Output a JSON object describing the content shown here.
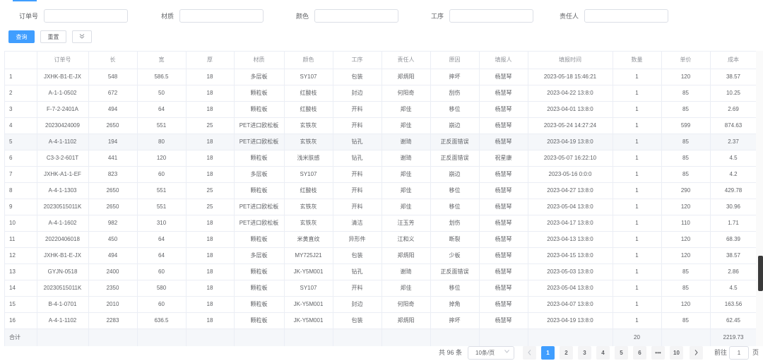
{
  "filters": [
    {
      "label": "订单号",
      "placeholder": "",
      "value": ""
    },
    {
      "label": "材质",
      "placeholder": "",
      "value": ""
    },
    {
      "label": "颜色",
      "placeholder": "",
      "value": ""
    },
    {
      "label": "工序",
      "placeholder": "",
      "value": ""
    },
    {
      "label": "责任人",
      "placeholder": "",
      "value": ""
    }
  ],
  "actions": {
    "search_label": "查询",
    "reset_label": "重置",
    "expand_icon": "chevron-double-down-icon"
  },
  "table": {
    "columns": [
      "",
      "订单号",
      "长",
      "宽",
      "厚",
      "材质",
      "颜色",
      "工序",
      "责任人",
      "原因",
      "填报人",
      "填报时间",
      "数量",
      "单价",
      "成本"
    ],
    "rows": [
      [
        "1",
        "JXHK-B1-E-JX",
        "548",
        "586.5",
        "18",
        "多层板",
        "SY107",
        "包装",
        "郑炳阳",
        "摔坏",
        "杨慧琴",
        "2023-05-18 15:46:21",
        "1",
        "120",
        "38.57"
      ],
      [
        "2",
        "A-1-1-0502",
        "672",
        "50",
        "18",
        "颗粒板",
        "红酸枝",
        "封边",
        "何阳奇",
        "刮伤",
        "杨慧琴",
        "2023-04-22 13:8:0",
        "1",
        "85",
        "10.25"
      ],
      [
        "3",
        "F-7-2-2401A",
        "494",
        "64",
        "18",
        "颗粒板",
        "红酸枝",
        "开料",
        "郑佳",
        "移位",
        "杨慧琴",
        "2023-04-01 13:8:0",
        "1",
        "85",
        "2.69"
      ],
      [
        "4",
        "20230424009",
        "2650",
        "551",
        "25",
        "PET进口欧松板",
        "玄铁灰",
        "开料",
        "郑佳",
        "崩边",
        "杨慧琴",
        "2023-05-24 14:27:24",
        "1",
        "599",
        "874.63"
      ],
      [
        "5",
        "A-4-1-1102",
        "194",
        "80",
        "18",
        "PET进口欧松板",
        "玄铁灰",
        "钻孔",
        "谢琦",
        "正反面错误",
        "杨慧琴",
        "2023-04-19 13:8:0",
        "1",
        "85",
        "2.37"
      ],
      [
        "6",
        "C3-3-2-601T",
        "441",
        "120",
        "18",
        "颗粒板",
        "浅米肤感",
        "钻孔",
        "谢琦",
        "正反面错误",
        "祝星康",
        "2023-05-07 16:22:10",
        "1",
        "85",
        "4.5"
      ],
      [
        "7",
        "JXHK-A1-1-EF",
        "823",
        "60",
        "18",
        "多层板",
        "SY107",
        "开料",
        "郑佳",
        "崩边",
        "杨慧琴",
        "2023-05-16 0:0:0",
        "1",
        "85",
        "4.2"
      ],
      [
        "8",
        "A-4-1-1303",
        "2650",
        "551",
        "25",
        "颗粒板",
        "红酸枝",
        "开料",
        "郑佳",
        "移位",
        "杨慧琴",
        "2023-04-27 13:8:0",
        "1",
        "290",
        "429.78"
      ],
      [
        "9",
        "20230515011K",
        "2650",
        "551",
        "25",
        "PET进口欧松板",
        "玄铁灰",
        "开料",
        "郑佳",
        "移位",
        "杨慧琴",
        "2023-05-04 13:8:0",
        "1",
        "120",
        "30.96"
      ],
      [
        "10",
        "A-4-1-1602",
        "982",
        "310",
        "18",
        "PET进口欧松板",
        "玄铁灰",
        "清洁",
        "汪玉芳",
        "划伤",
        "杨慧琴",
        "2023-04-17 13:8:0",
        "1",
        "110",
        "1.71"
      ],
      [
        "11",
        "20220406018",
        "450",
        "64",
        "18",
        "颗粒板",
        "米黄直纹",
        "异形件",
        "江和义",
        "断裂",
        "杨慧琴",
        "2023-04-13 13:8:0",
        "1",
        "120",
        "68.39"
      ],
      [
        "12",
        "JXHK-B1-E-JX",
        "494",
        "64",
        "18",
        "多层板",
        "MY725J21",
        "包装",
        "郑炳阳",
        "少板",
        "杨慧琴",
        "2023-04-15 13:8:0",
        "1",
        "120",
        "38.57"
      ],
      [
        "13",
        "GYJN-0518",
        "2400",
        "60",
        "18",
        "颗粒板",
        "JK-Y5M001",
        "钻孔",
        "谢琦",
        "正反面错误",
        "杨慧琴",
        "2023-05-03 13:8:0",
        "1",
        "85",
        "2.86"
      ],
      [
        "14",
        "20230515011K",
        "2350",
        "580",
        "18",
        "颗粒板",
        "SY107",
        "开料",
        "郑佳",
        "移位",
        "杨慧琴",
        "2023-05-04 13:8:0",
        "1",
        "85",
        "4.5"
      ],
      [
        "15",
        "B-4-1-0701",
        "2010",
        "60",
        "18",
        "颗粒板",
        "JK-Y5M001",
        "封边",
        "何阳奇",
        "掉角",
        "杨慧琴",
        "2023-04-07 13:8:0",
        "1",
        "120",
        "163.56"
      ],
      [
        "16",
        "A-4-1-1102",
        "2283",
        "636.5",
        "18",
        "颗粒板",
        "JK-Y5M001",
        "包装",
        "郑炳阳",
        "摔坏",
        "杨慧琴",
        "2023-04-19 13:8:0",
        "1",
        "85",
        "62.45"
      ]
    ],
    "highlighted_row": 5,
    "summary": {
      "label": "合计",
      "quantity": "20",
      "cost": "2219.73"
    }
  },
  "pagination": {
    "total_text": "共 96 条",
    "page_size": "10条/页",
    "prev_icon": "chevron-left-icon",
    "next_icon": "chevron-right-icon",
    "pages": [
      "1",
      "2",
      "3",
      "4",
      "5",
      "6",
      "•••",
      "10"
    ],
    "active_page": "1",
    "goto_label": "前往",
    "goto_value": "1",
    "page_unit": "页"
  },
  "colors": {
    "primary": "#409eff",
    "border": "#ebeef5",
    "header_text": "#909399",
    "highlight": "#f5f7fa"
  }
}
